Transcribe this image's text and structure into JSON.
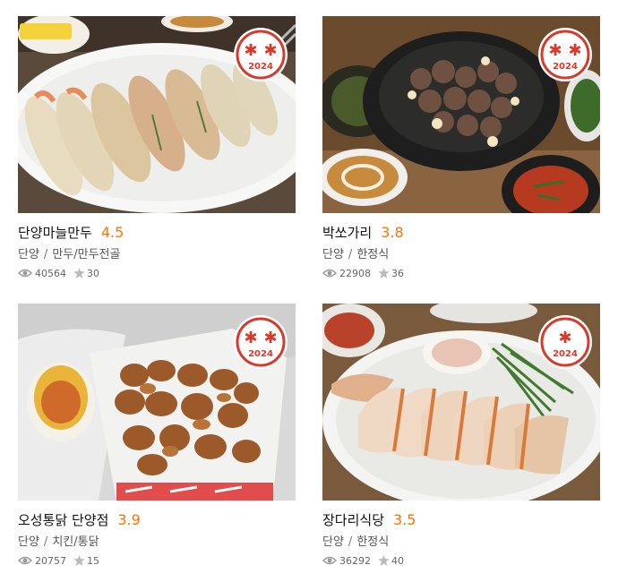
{
  "colors": {
    "rating": "#ff7100",
    "badge_red": "#d9382b",
    "name": "#111111",
    "meta": "#555555"
  },
  "icons": {
    "views": "eye-icon",
    "favorites": "star-icon",
    "badge": "award-badge-icon"
  },
  "restaurants": [
    {
      "name": "단양마늘만두",
      "rating": "4.5",
      "region": "단양",
      "category": "만두/만두전골",
      "views": "40564",
      "favorites": "30",
      "badge_year": "2024",
      "badge_marks": 2
    },
    {
      "name": "박쏘가리",
      "rating": "3.8",
      "region": "단양",
      "category": "한정식",
      "views": "22908",
      "favorites": "36",
      "badge_year": "2024",
      "badge_marks": 2
    },
    {
      "name": "오성통닭 단양점",
      "rating": "3.9",
      "region": "단양",
      "category": "치킨/통닭",
      "views": "20757",
      "favorites": "15",
      "badge_year": "2024",
      "badge_marks": 2
    },
    {
      "name": "장다리식당",
      "rating": "3.5",
      "region": "단양",
      "category": "한정식",
      "views": "36292",
      "favorites": "40",
      "badge_year": "2024",
      "badge_marks": 1
    }
  ]
}
